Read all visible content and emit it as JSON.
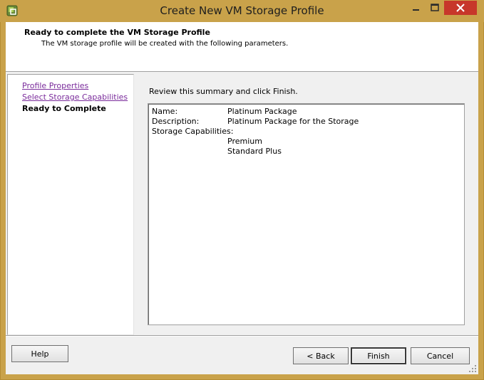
{
  "window": {
    "title": "Create New VM Storage Profile"
  },
  "header": {
    "title": "Ready to complete the VM Storage Profile",
    "subtitle": "The VM storage profile will be created with the following parameters."
  },
  "steps": [
    {
      "label": "Profile Properties",
      "state": "visited"
    },
    {
      "label": "Select Storage Capabilities",
      "state": "visited"
    },
    {
      "label": "Ready to Complete",
      "state": "current"
    }
  ],
  "review": {
    "instruction": "Review this summary and click Finish.",
    "fields": {
      "name_label": "Name:",
      "name_value": "Platinum Package",
      "description_label": "Description:",
      "description_value": "Platinum Package for the Storage",
      "capabilities_label": "Storage Capabilities:",
      "capabilities": [
        "Premium",
        "Standard Plus"
      ]
    }
  },
  "buttons": {
    "help": "Help",
    "back": "< Back",
    "finish": "Finish",
    "cancel": "Cancel"
  },
  "icons": {
    "app": "vsphere-app-icon",
    "minimize": "minimize-icon",
    "maximize": "maximize-icon",
    "close": "close-icon",
    "resize": "resize-grip-icon"
  },
  "colors": {
    "window_frame": "#c9a24a",
    "close_button": "#c7372a",
    "visited_link": "#7a2b9b"
  }
}
